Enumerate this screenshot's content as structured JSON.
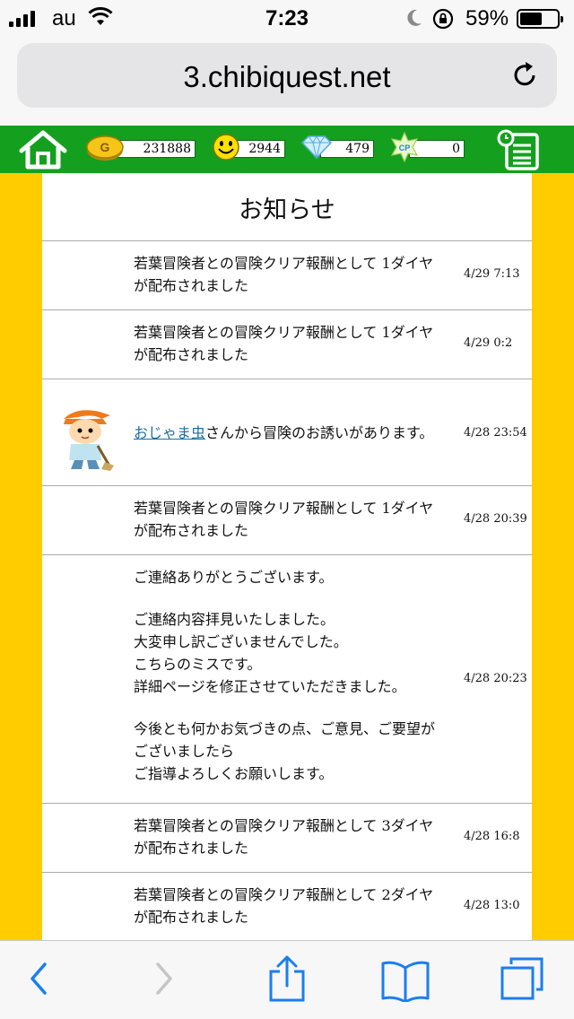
{
  "status_bar": {
    "carrier": "au",
    "time": "7:23",
    "battery_percent": "59%",
    "battery_level": 0.59
  },
  "browser": {
    "url": "3.chibiquest.net"
  },
  "game_header": {
    "gold": "231888",
    "smile": "2944",
    "diamond": "479",
    "cp_label": "CP",
    "cp": "0",
    "gold_icon_letter": "G"
  },
  "panel": {
    "title": "お知らせ",
    "notices": [
      {
        "msg": [
          "若葉冒険者との冒険クリア報酬として 1ダイヤ",
          "が配布されました"
        ],
        "date": "4/29 7:13"
      },
      {
        "msg": [
          "若葉冒険者との冒険クリア報酬として 1ダイヤ",
          "が配布されました"
        ],
        "date": "4/29 0:2"
      },
      {
        "link": "おじゃま虫",
        "msg_after": "さんから冒険のお誘いがあります。",
        "date": "4/28 23:54"
      },
      {
        "msg": [
          "若葉冒険者との冒険クリア報酬として 1ダイヤ",
          "が配布されました"
        ],
        "date": "4/28 20:39"
      },
      {
        "paragraphs": [
          [
            "ご連絡ありがとうございます。"
          ],
          [
            "ご連絡内容拝見いたしました。",
            "大変申し訳ございませんでした。",
            "こちらのミスです。",
            "詳細ページを修正させていただきました。"
          ],
          [
            "今後とも何かお気づきの点、ご意見、ご要望が",
            "ございましたら",
            "ご指導よろしくお願いします。"
          ]
        ],
        "date": "4/28 20:23"
      },
      {
        "msg": [
          "若葉冒険者との冒険クリア報酬として 3ダイヤ",
          "が配布されました"
        ],
        "date": "4/28 16:8"
      },
      {
        "msg": [
          "若葉冒険者との冒険クリア報酬として 2ダイヤ",
          "が配布されました"
        ],
        "date": "4/28 13:0"
      }
    ]
  },
  "icons": {
    "home": "home-icon",
    "gold": "gold-coin-icon",
    "smile": "smile-icon",
    "diamond": "diamond-icon",
    "cp": "cp-star-icon",
    "menu": "notice-list-icon",
    "back": "back-icon",
    "forward": "forward-icon",
    "share": "share-icon",
    "bookmarks": "bookmarks-icon",
    "tabs": "tabs-icon",
    "reload": "reload-icon"
  },
  "colors": {
    "header_green": "#14a01e",
    "side_yellow": "#ffcc00",
    "link_blue": "#1a6fa0",
    "ios_blue": "#1a7ef2"
  }
}
